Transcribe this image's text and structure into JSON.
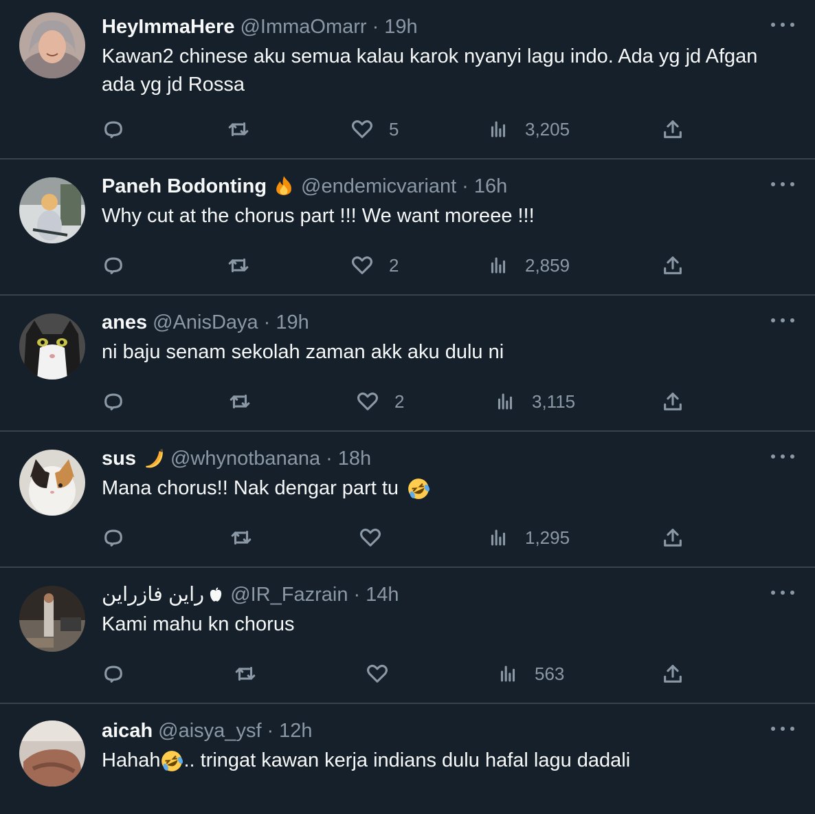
{
  "tweets": [
    {
      "name": "HeyImmaHere",
      "handle": "@ImmaOmarr",
      "time": "19h",
      "text": "Kawan2 chinese aku semua kalau karok nyanyi lagu indo. Ada yg jd Afgan ada yg jd Rossa",
      "likes": "5",
      "views": "3,205"
    },
    {
      "name": "Paneh Bodonting",
      "handle": "@endemicvariant",
      "time": "16h",
      "text": "Why cut at the chorus part !!! We want moreee !!!",
      "likes": "2",
      "views": "2,859",
      "name_emoji": "fire-emoji"
    },
    {
      "name": "anes",
      "handle": "@AnisDaya",
      "time": "19h",
      "text": "ni baju senam sekolah zaman akk aku dulu ni",
      "likes": "2",
      "views": "3,115"
    },
    {
      "name": "sus",
      "handle": "@whynotbanana",
      "time": "18h",
      "text": "Mana chorus!! Nak dengar part tu",
      "likes": "",
      "views": "1,295",
      "name_emoji": "banana-emoji",
      "text_emoji": "rofl-emoji"
    },
    {
      "name": "راين فازراين",
      "handle": "@IR_Fazrain",
      "time": "14h",
      "text": "Kami mahu kn chorus",
      "likes": "",
      "views": "563",
      "name_emoji": "apple-logo"
    },
    {
      "name": "aicah",
      "handle": "@aisya_ysf",
      "time": "12h",
      "text_before": "Hahah",
      "text_after": ".. tringat kawan kerja indians dulu hafal lagu dadali",
      "text_emoji": "rofl-emoji"
    }
  ],
  "icons": {
    "reply": "reply-icon",
    "retweet": "retweet-icon",
    "like": "heart-icon",
    "views": "views-icon",
    "share": "share-icon",
    "more": "more-icon"
  },
  "colors": {
    "background": "#15202b",
    "divider": "#38444d",
    "muted": "#8b98a5",
    "text": "#f7f9f9"
  }
}
